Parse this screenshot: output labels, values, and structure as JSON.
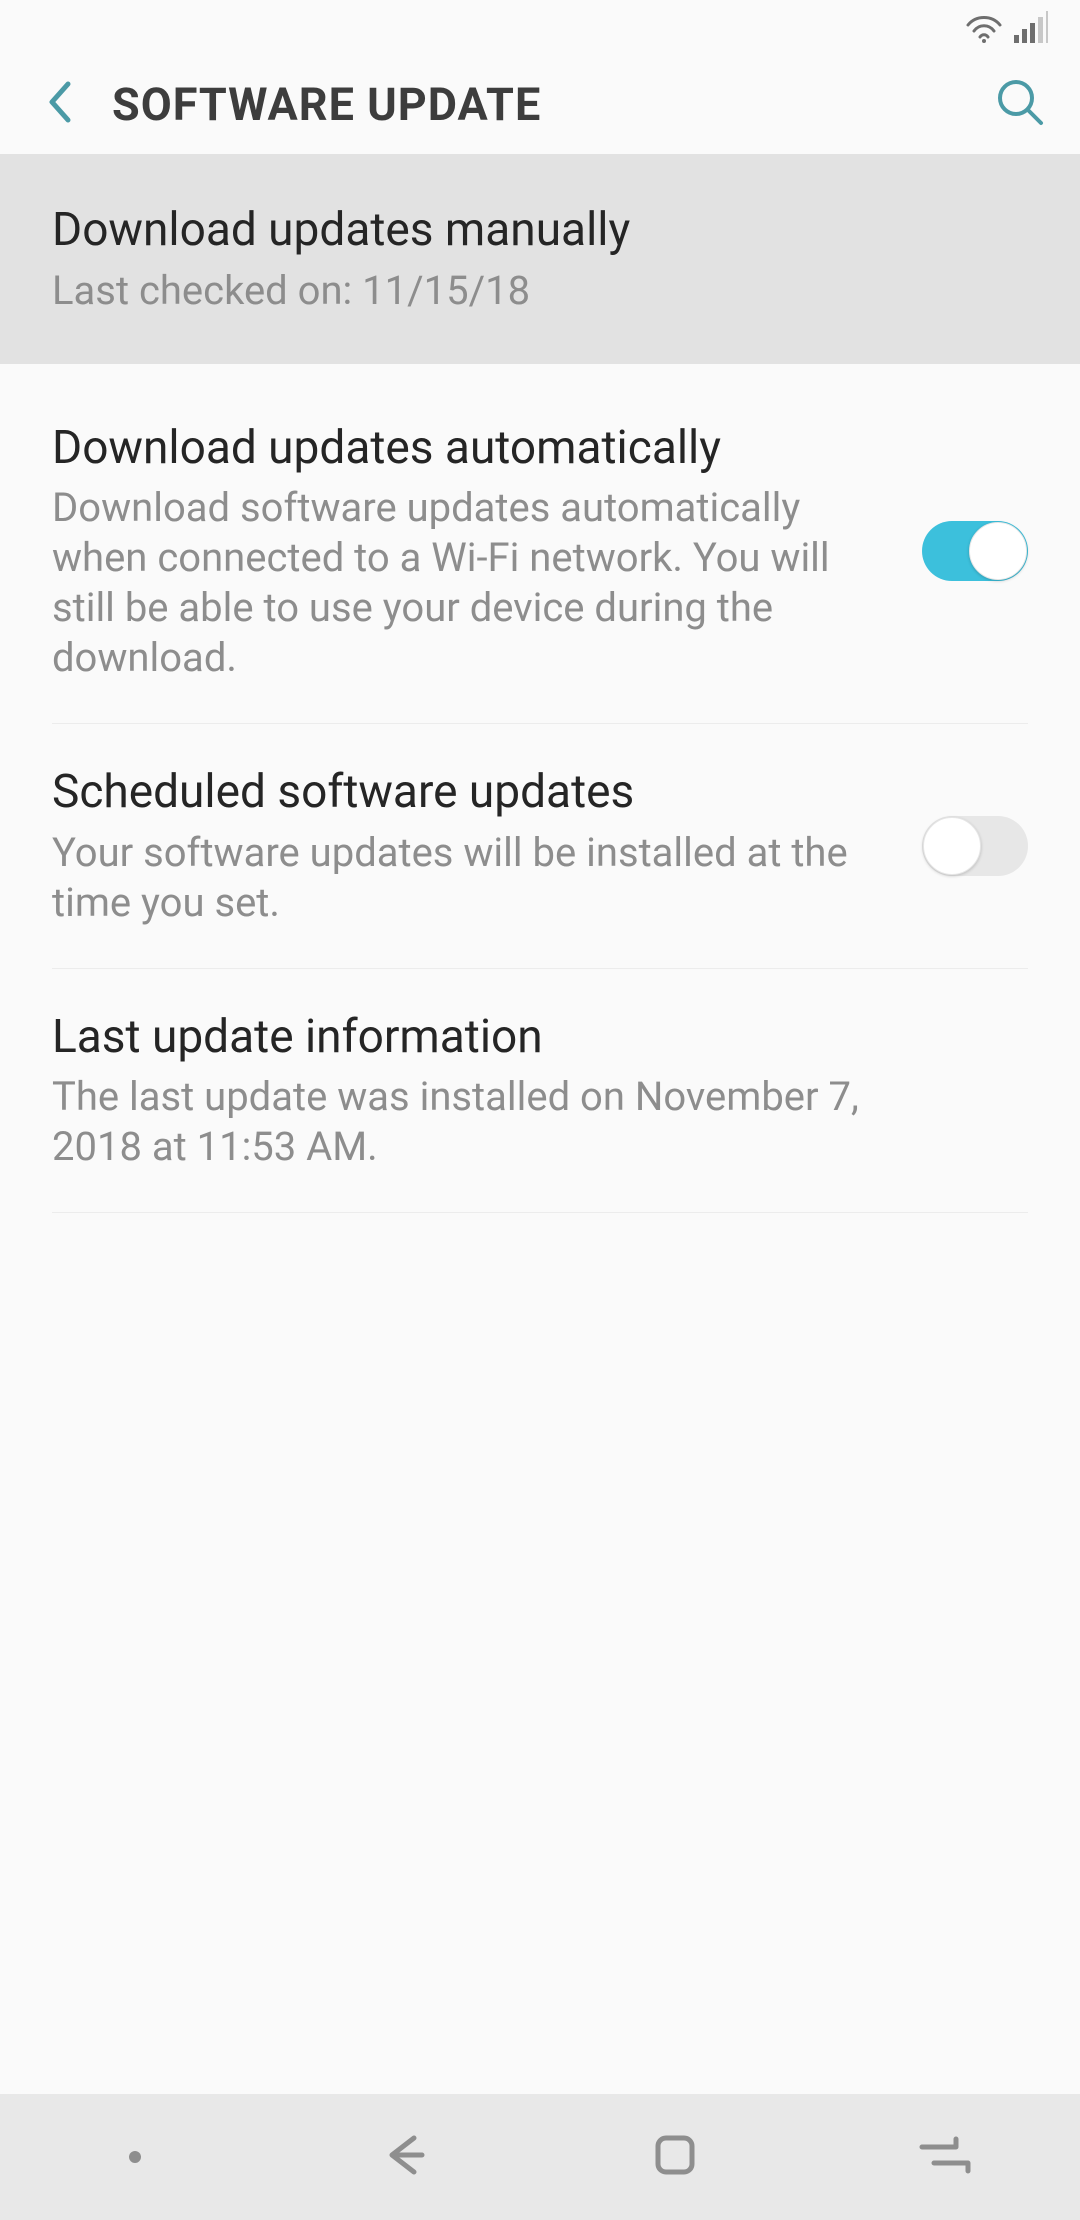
{
  "header": {
    "title": "SOFTWARE UPDATE"
  },
  "items": [
    {
      "title": "Download updates manually",
      "subtitle": "Last checked on: 11/15/18"
    },
    {
      "title": "Download updates automatically",
      "subtitle": "Download software updates automatically when connected to a Wi-Fi network. You will still be able to use your device during the download.",
      "toggle": true
    },
    {
      "title": "Scheduled software updates",
      "subtitle": "Your software updates will be installed at the time you set.",
      "toggle": false
    },
    {
      "title": "Last update information",
      "subtitle": "The last update was installed on November 7, 2018 at 11:53 AM."
    }
  ],
  "colors": {
    "accent": "#3cc0dc",
    "icon_teal": "#4b9aa6"
  }
}
